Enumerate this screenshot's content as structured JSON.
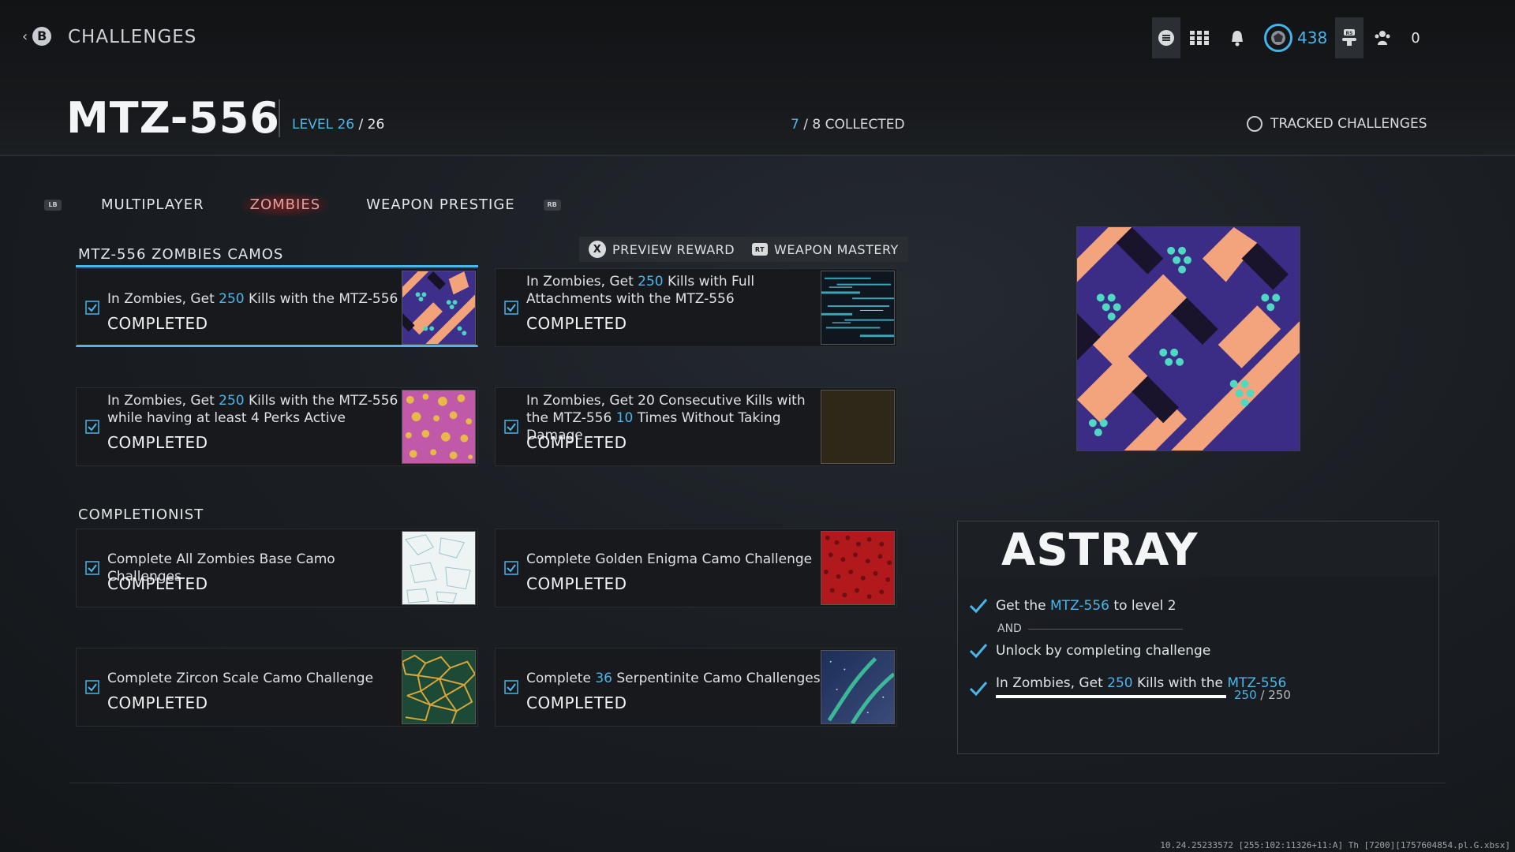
{
  "header": {
    "back_button": "B",
    "breadcrumb": "CHALLENGES",
    "cod_points": "438",
    "counter": "0"
  },
  "weapon": {
    "name": "MTZ-556",
    "level_label": "LEVEL",
    "level_current": "26",
    "level_max": "26",
    "collected_current": "7",
    "collected_total": "8",
    "collected_label": "COLLECTED",
    "tracked_label": "TRACKED CHALLENGES"
  },
  "tabs": {
    "lb": "LB",
    "rb": "RB",
    "items": [
      "MULTIPLAYER",
      "ZOMBIES",
      "WEAPON PRESTIGE"
    ],
    "active": "ZOMBIES"
  },
  "buttons": {
    "preview_reward": "PREVIEW REWARD",
    "preview_key": "X",
    "weapon_mastery": "WEAPON MASTERY",
    "weapon_mastery_key": "RT"
  },
  "sections": {
    "camos_title": "MTZ-556 ZOMBIES CAMOS",
    "completionist_title": "COMPLETIONIST"
  },
  "cards": [
    {
      "pre": "In Zombies, Get ",
      "hl": "250",
      "post": " Kills with the MTZ-556",
      "status": "COMPLETED"
    },
    {
      "pre": "In Zombies, Get ",
      "hl": "250",
      "post": " Kills with Full Attachments with the MTZ-556",
      "status": "COMPLETED"
    },
    {
      "pre": "In Zombies, Get ",
      "hl": "250",
      "post": " Kills with the MTZ-556 while having at least 4 Perks Active",
      "status": "COMPLETED"
    },
    {
      "pre": "In Zombies, Get 20 Consecutive Kills with the MTZ-556 ",
      "hl": "10",
      "post": " Times Without Taking Damage",
      "status": "COMPLETED"
    },
    {
      "pre": "Complete All Zombies Base Camo Challenges",
      "hl": "",
      "post": "",
      "status": "COMPLETED"
    },
    {
      "pre": "Complete Golden Enigma Camo Challenge",
      "hl": "",
      "post": "",
      "status": "COMPLETED"
    },
    {
      "pre": "Complete Zircon Scale Camo Challenge",
      "hl": "",
      "post": "",
      "status": "COMPLETED"
    },
    {
      "pre": "Complete ",
      "hl": "36",
      "post": " Serpentinite Camo Challenges",
      "status": "COMPLETED"
    }
  ],
  "reward": {
    "name": "ASTRAY",
    "req1_pre": "Get the ",
    "req1_hl": "MTZ-556",
    "req1_post": " to level 2",
    "and_label": "AND",
    "req2": "Unlock by completing challenge",
    "req3_pre": "In Zombies, Get ",
    "req3_hl": "250",
    "req3_mid": " Kills with the ",
    "req3_hl2": "MTZ-556",
    "progress_current": "250",
    "progress_max": "250",
    "progress_fraction": 1.0
  },
  "build_string": "10.24.25233572 [255:102:11326+11:A] Th [7200][1757604854.pl.G.xbsx]",
  "colors": {
    "accent": "#4ab6ea",
    "active_tab": "#a52222",
    "panel": "#17191c"
  }
}
